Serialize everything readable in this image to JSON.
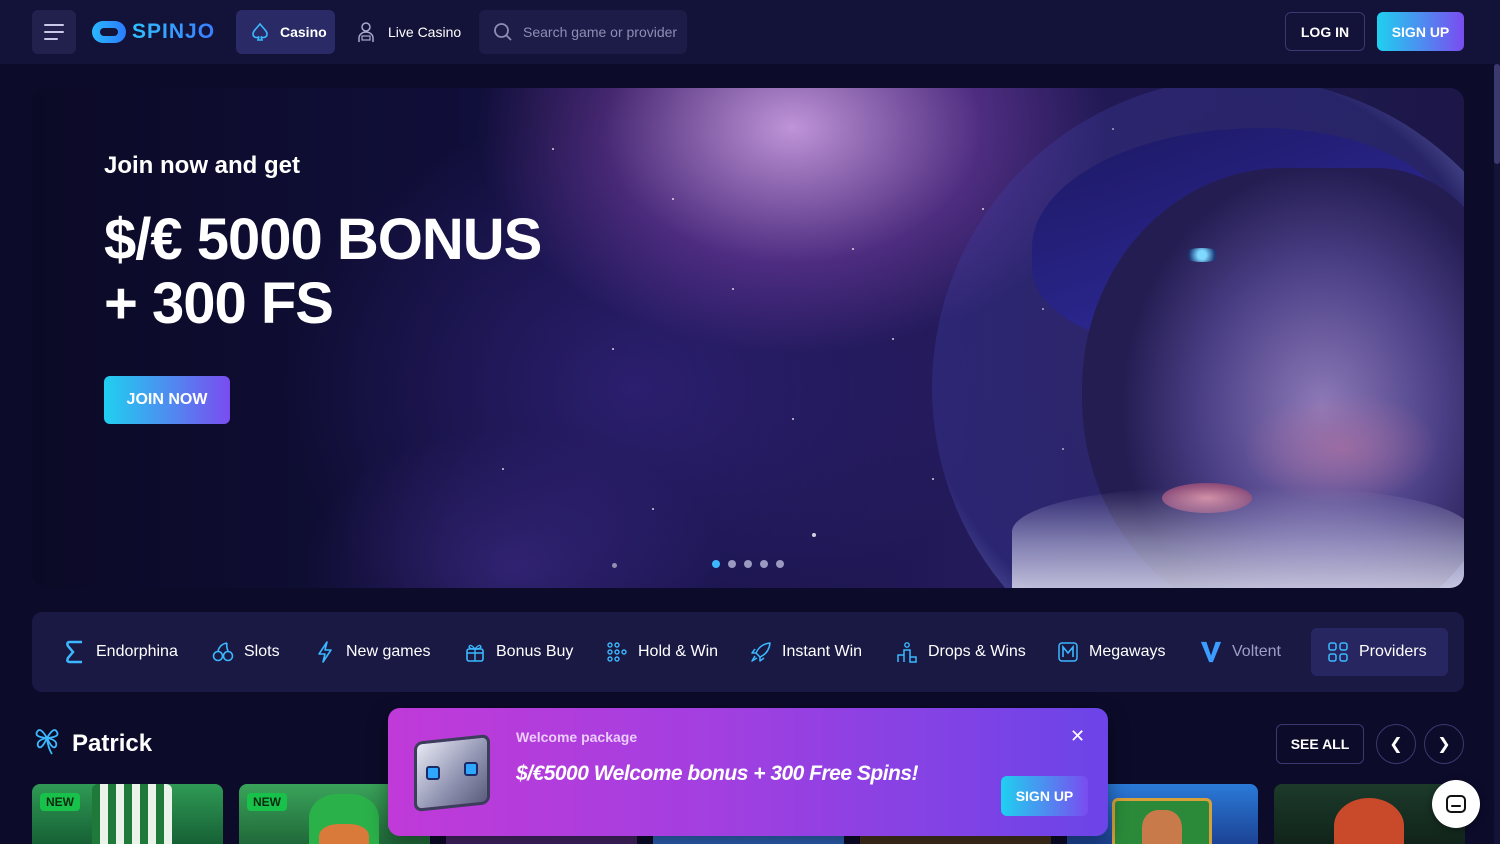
{
  "header": {
    "logo_text": "SPINJO",
    "nav": [
      {
        "label": "Casino",
        "icon": "spade-icon",
        "active": true
      },
      {
        "label": "Live Casino",
        "icon": "dealer-icon",
        "active": false
      }
    ],
    "search": {
      "placeholder": "Search game or provider"
    },
    "login_label": "LOG IN",
    "signup_label": "SIGN UP"
  },
  "hero": {
    "subtitle": "Join now and get",
    "title_line1": "$/€ 5000 BONUS",
    "title_line2": "+ 300 FS",
    "cta_label": "JOIN NOW",
    "slides_count": 5,
    "active_slide": 1
  },
  "categories": [
    {
      "label": "Endorphina",
      "icon": "endorphina-logo-icon"
    },
    {
      "label": "Slots",
      "icon": "slots-icon"
    },
    {
      "label": "New games",
      "icon": "lightning-icon"
    },
    {
      "label": "Bonus Buy",
      "icon": "gift-icon"
    },
    {
      "label": "Hold & Win",
      "icon": "grid-dots-icon"
    },
    {
      "label": "Instant Win",
      "icon": "rocket-icon"
    },
    {
      "label": "Drops & Wins",
      "icon": "podium-icon"
    },
    {
      "label": "Megaways",
      "icon": "megaways-icon"
    },
    {
      "label": "Voltent",
      "icon": "voltent-logo-icon"
    },
    {
      "label": "Providers",
      "icon": "providers-grid-icon"
    }
  ],
  "section": {
    "title": "Patrick",
    "icon": "clover-icon",
    "see_all_label": "SEE ALL",
    "tiles": [
      {
        "badge": "NEW"
      },
      {
        "badge": "NEW"
      },
      {
        "badge": ""
      },
      {
        "badge": ""
      },
      {
        "badge": ""
      },
      {
        "badge": ""
      },
      {
        "badge": ""
      }
    ]
  },
  "popup": {
    "subtitle": "Welcome package",
    "title": "$/€5000 Welcome bonus + 300 Free Spins!",
    "signup_label": "SIGN UP",
    "close_symbol": "✕"
  },
  "colors": {
    "background": "#0c0b2a",
    "header": "#131238",
    "accent_blue": "#3bb8ff",
    "gradient_start": "#1fd0f0",
    "gradient_end": "#7a4cf0",
    "new_badge": "#18c24a"
  }
}
